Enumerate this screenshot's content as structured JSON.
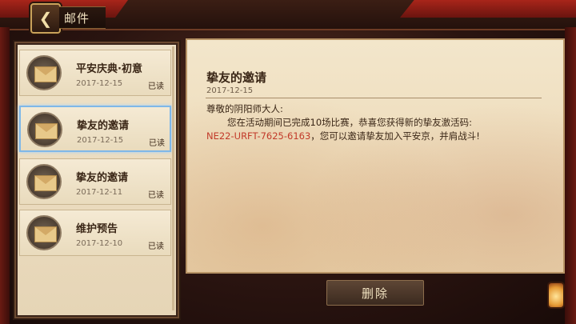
{
  "header": {
    "back_icon": "back-arrow-icon",
    "title": "邮件"
  },
  "mail_list": [
    {
      "title": "平安庆典·初意",
      "date": "2017-12-15",
      "status": "已读",
      "selected": false
    },
    {
      "title": "挚友的邀请",
      "date": "2017-12-15",
      "status": "已读",
      "selected": true
    },
    {
      "title": "挚友的邀请",
      "date": "2017-12-11",
      "status": "已读",
      "selected": false
    },
    {
      "title": "维护预告",
      "date": "2017-12-10",
      "status": "已读",
      "selected": false
    }
  ],
  "letter": {
    "title": "挚友的邀请",
    "date": "2017-12-15",
    "greeting": "尊敬的阴阳师大人:",
    "line1": "您在活动期间已完成10场比赛，恭喜您获得新的挚友激活码:",
    "code": "NE22-URFT-7625-6163",
    "line2_rest": "，您可以邀请挚友加入平安京，并肩战斗!"
  },
  "actions": {
    "delete_label": "删除"
  },
  "colors": {
    "selected_border": "#7fb8e8",
    "code_color": "#c23a2a"
  }
}
